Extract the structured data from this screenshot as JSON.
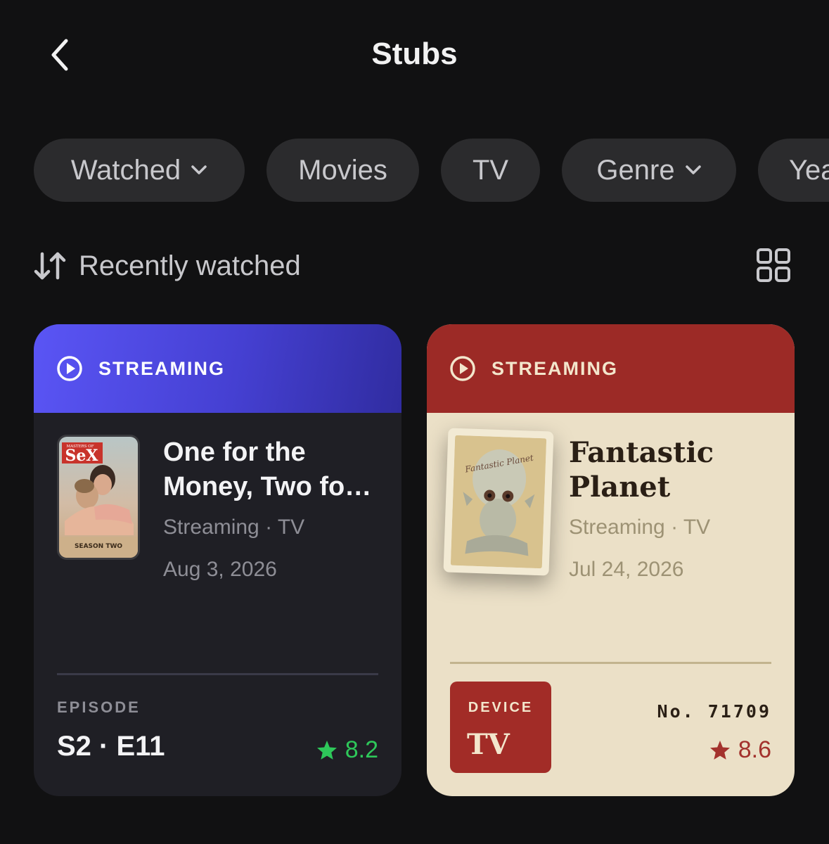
{
  "header": {
    "title": "Stubs"
  },
  "filters": [
    {
      "label": "Watched",
      "dropdown": true
    },
    {
      "label": "Movies",
      "dropdown": false
    },
    {
      "label": "TV",
      "dropdown": false
    },
    {
      "label": "Genre",
      "dropdown": true
    },
    {
      "label": "Yea",
      "dropdown": false
    }
  ],
  "sort": {
    "label": "Recently watched"
  },
  "cards": [
    {
      "kind": "STREAMING",
      "title": "One for the Money, Two fo…",
      "subtitle": "Streaming · TV",
      "date": "Aug 3, 2026",
      "poster": {
        "series": "MASTERS OF",
        "logo": "SeX",
        "caption": "SEASON TWO"
      },
      "episode_label": "EPISODE",
      "episode": "S2 · E11",
      "rating": "8.2",
      "accent": "#5a55f5",
      "rating_color": "#2ec85a"
    },
    {
      "kind": "STREAMING",
      "title": "Fantastic Planet",
      "subtitle": "Streaming · TV",
      "date": "Jul 24, 2026",
      "poster": {
        "title": "Fantastic Planet"
      },
      "device_label": "DEVICE",
      "device": "TV",
      "number": "No. 71709",
      "rating": "8.6",
      "accent": "#9c2a26",
      "rating_color": "#a3322d"
    }
  ]
}
